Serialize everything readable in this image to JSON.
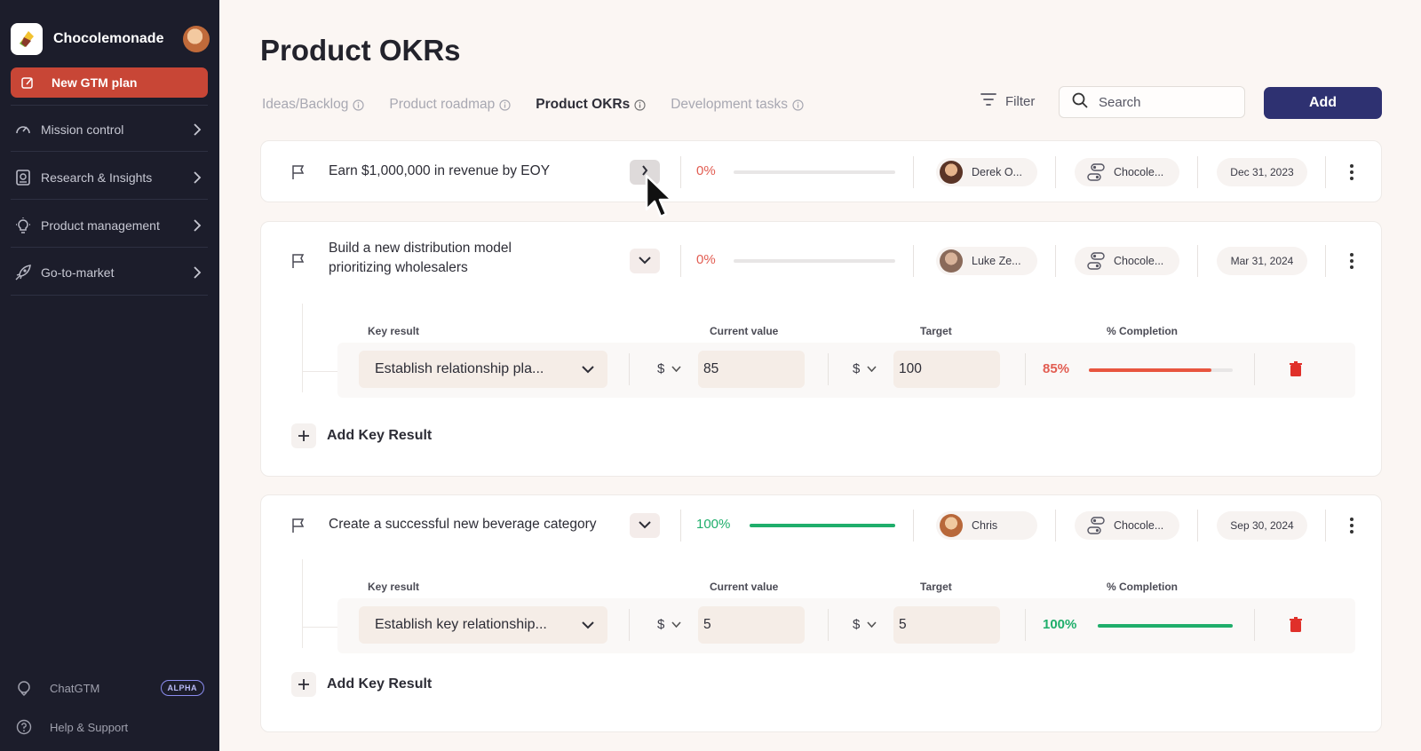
{
  "sidebar": {
    "brand_name": "Chocolemonade",
    "new_plan_label": "New GTM plan",
    "nav_items": [
      {
        "label": "Mission control",
        "icon": "gauge-icon"
      },
      {
        "label": "Research & Insights",
        "icon": "research-icon"
      },
      {
        "label": "Product management",
        "icon": "lightbulb-icon"
      },
      {
        "label": "Go-to-market",
        "icon": "rocket-icon"
      }
    ],
    "chat_label": "ChatGTM",
    "alpha_badge": "ALPHA",
    "help_label": "Help & Support"
  },
  "header": {
    "title": "Product OKRs",
    "tabs": [
      {
        "label": "Ideas/Backlog",
        "active": false
      },
      {
        "label": "Product roadmap",
        "active": false
      },
      {
        "label": "Product OKRs",
        "active": true
      },
      {
        "label": "Development tasks",
        "active": false
      }
    ],
    "filter_label": "Filter",
    "search_placeholder": "Search",
    "add_label": "Add"
  },
  "objectives": [
    {
      "title": "Earn $1,000,000 in revenue by EOY",
      "progress_label": "0%",
      "progress": 0,
      "owner": "Derek O...",
      "team": "Chocole...",
      "date": "Dec 31, 2023",
      "expanded": false
    },
    {
      "title_line1": "Build a new distribution model",
      "title_line2": "prioritizing wholesalers",
      "progress_label": "0%",
      "progress": 0,
      "owner": "Luke Ze...",
      "team": "Chocole...",
      "date": "Mar 31, 2024",
      "expanded": true,
      "key_results": [
        {
          "name": "Establish relationship pla...",
          "current_currency": "$",
          "current_value": "85",
          "target_currency": "$",
          "target_value": "100",
          "completion_label": "85%",
          "completion": 0.85
        }
      ]
    },
    {
      "title": "Create a successful new beverage category",
      "progress_label": "100%",
      "progress": 1.0,
      "owner": "Chris",
      "team": "Chocole...",
      "date": "Sep 30, 2024",
      "expanded": true,
      "key_results": [
        {
          "name": "Establish key relationship...",
          "current_currency": "$",
          "current_value": "5",
          "target_currency": "$",
          "target_value": "5",
          "completion_label": "100%",
          "completion": 1.0
        }
      ]
    }
  ],
  "kr_headers": {
    "key_result": "Key result",
    "current_value": "Current value",
    "target": "Target",
    "completion": "% Completion"
  },
  "add_key_result_label": "Add Key Result",
  "colors": {
    "sidebar_bg": "#1c1d2b",
    "accent_red": "#c84636",
    "add_button": "#2e3171",
    "progress_red": "#e25d52",
    "progress_green": "#1fae6b"
  }
}
